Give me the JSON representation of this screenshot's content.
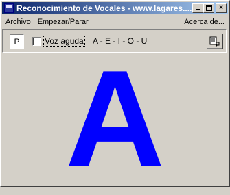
{
  "window": {
    "title": "Reconocimiento de Vocales - www.lagares....",
    "controls": {
      "minimize": "minimize",
      "maximize": "maximize",
      "close": "×"
    }
  },
  "menu": {
    "items": [
      {
        "label": "Archivo",
        "mnemonic": "A"
      },
      {
        "label": "Empezar/Parar",
        "mnemonic": "E"
      }
    ],
    "right_item": {
      "label": "Acerca de..."
    }
  },
  "toolbar": {
    "p_button_label": "P",
    "checkbox_label": "Voz aguda",
    "checkbox_checked": false,
    "vowels": "A - E - I - O - U",
    "tool_button_icon": "notes-tool-icon"
  },
  "display": {
    "current_vowel": "A",
    "color": "#0000ff"
  },
  "colors": {
    "face": "#d4d0c8",
    "title_start": "#0a246a",
    "title_end": "#a6caf0"
  }
}
